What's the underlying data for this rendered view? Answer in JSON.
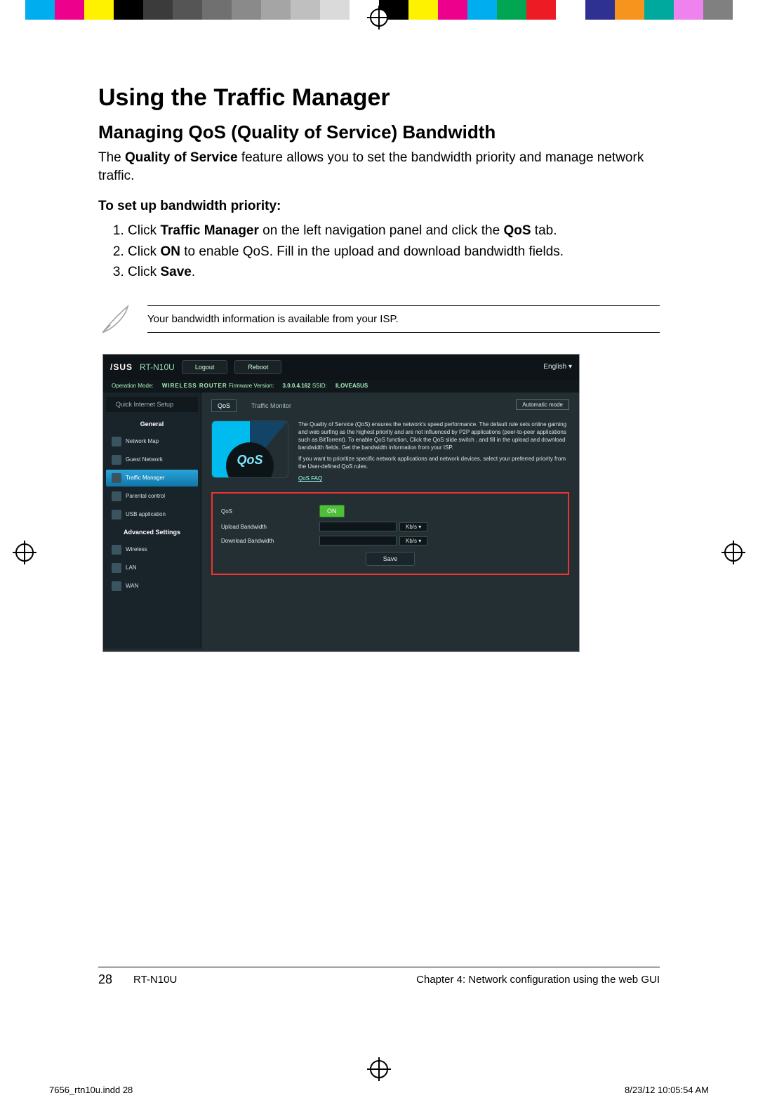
{
  "colorbar": [
    "#00aeef",
    "#ec008c",
    "#fff200",
    "#000000",
    "#3b3b3b",
    "#555555",
    "#707070",
    "#8a8a8a",
    "#a5a5a5",
    "#bfbfbf",
    "#dadada",
    "#ffffff",
    "#000000",
    "#fff200",
    "#ec008c",
    "#00aeef",
    "#00a651",
    "#ed1c24",
    "#ffffff",
    "#2e3192",
    "#f7941d",
    "#00a99d",
    "#ee82ee",
    "#808080"
  ],
  "h1": "Using the Traffic Manager",
  "h2": "Managing QoS (Quality of Service) Bandwidth",
  "intro_pre": "The ",
  "intro_bold": "Quality of Service",
  "intro_post": " feature allows you to set the bandwidth priority and manage network traffic.",
  "subhead": "To set up bandwidth priority:",
  "steps": {
    "s1_a": "Click ",
    "s1_b": "Traffic Manager",
    "s1_c": " on the left navigation panel and click the ",
    "s1_d": "QoS",
    "s1_e": " tab.",
    "s2_a": "Click ",
    "s2_b": "ON",
    "s2_c": " to enable QoS. Fill in the upload and download bandwidth fields.",
    "s3_a": "Click ",
    "s3_b": "Save",
    "s3_c": "."
  },
  "note": "Your bandwidth information is available from your ISP.",
  "router_ui": {
    "brand": "/SUS",
    "model": "RT-N10U",
    "btn_logout": "Logout",
    "btn_reboot": "Reboot",
    "lang": "English   ▾",
    "info_opmode_label": "Operation Mode:",
    "info_opmode": "WIRELESS ROUTER",
    "info_fw_label": "Firmware Version:",
    "info_fw": "3.0.0.4.162",
    "info_ssid_label": "SSID:",
    "info_ssid": "ILOVEASUS",
    "qis": "Quick Internet Setup",
    "group_general": "General",
    "side": {
      "map": "Network Map",
      "guest": "Guest Network",
      "traffic": "Traffic Manager",
      "parental": "Parental control",
      "usb": "USB application"
    },
    "group_adv": "Advanced Settings",
    "side_adv": {
      "wireless": "Wireless",
      "lan": "LAN",
      "wan": "WAN"
    },
    "subtab_qos": "QoS",
    "subtab_tm": "Traffic Monitor",
    "mode": "Automatic mode",
    "desc": "The Quality of Service (QoS) ensures the network's speed performance. The default rule sets online gaming and web surfing as the highest priority and are not influenced by P2P applications (peer-to-peer applications such as BitTorrent). To enable QoS function, Click the QoS slide switch , and fill in the upload and download bandwidth fields. Get the bandwidth information from your ISP.",
    "desc2": "If you want to prioritize specific network applications and network devices, select your preferred priority from the User-defined QoS rules.",
    "faq": "QoS FAQ",
    "form": {
      "lbl_qos": "QoS",
      "on": "ON",
      "lbl_up": "Upload Bandwidth",
      "lbl_down": "Download Bandwidth",
      "unit": "Kb/s ▾",
      "save": "Save"
    }
  },
  "footer": {
    "page": "28",
    "model": "RT-N10U",
    "chapter": "Chapter 4: Network configuration using the web GUI"
  },
  "print": {
    "left": "7656_rtn10u.indd   28",
    "right": "8/23/12   10:05:54 AM"
  }
}
